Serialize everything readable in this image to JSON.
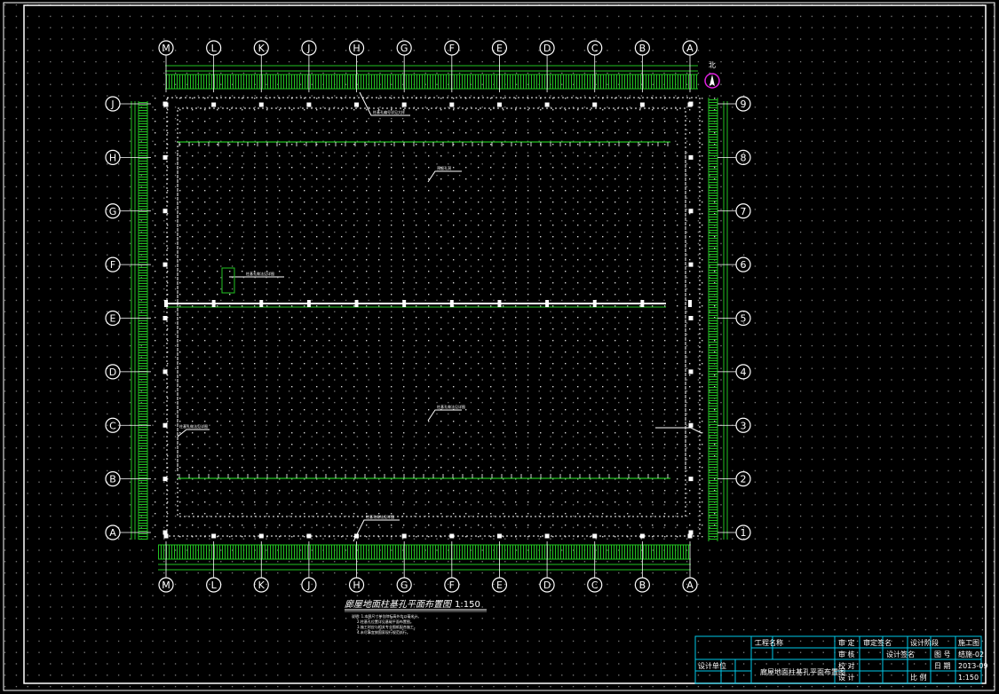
{
  "drawing": {
    "title": "廊屋地面柱基孔平面布置图",
    "scale": "1:150",
    "north_label": "北",
    "notes": [
      "说明: 1.本图尺寸单位除标高外均以毫米计。",
      "2.柱基孔位置详见基础平面布置图。",
      "3.施工时应与相关专业图纸配合施工。",
      "4.未尽事宜按国家现行规范执行。"
    ]
  },
  "grid": {
    "top_columns": [
      "M",
      "L",
      "K",
      "J",
      "H",
      "G",
      "F",
      "E",
      "D",
      "C",
      "B",
      "A"
    ],
    "bottom_columns": [
      "M",
      "L",
      "K",
      "J",
      "H",
      "G",
      "F",
      "E",
      "D",
      "C",
      "B",
      "A"
    ],
    "left_rows": [
      "J",
      "H",
      "G",
      "F",
      "E",
      "D",
      "C",
      "B",
      "A"
    ],
    "right_rows": [
      "9",
      "8",
      "7",
      "6",
      "5",
      "4",
      "3",
      "2",
      "1"
    ]
  },
  "callouts": [
    "柱基孔编号详见大样",
    "预留孔洞",
    "柱基孔做法见详图",
    "柱基孔做法见详图",
    "柱基孔做法见详图",
    "柱基孔做法见详图"
  ],
  "title_block": {
    "project_label": "工程名称",
    "drawing_name": "廊屋地面柱基孔平面布置图",
    "design_unit": "设计单位",
    "roles": [
      "审 定",
      "审 核",
      "校 对",
      "设 计"
    ],
    "stage_label": "设计阶段",
    "stage_value": "施工图",
    "sheet_no_label": "图 号",
    "sheet_no": "结施-02",
    "date_label": "日 期",
    "date": "2013-09",
    "scale_label": "比 例",
    "scale_value": "1:150",
    "checked": "审定签名",
    "drawn": "设计签名"
  },
  "colors": {
    "background": "#000000",
    "line": "#ffffff",
    "dimension": "#22c322",
    "titleblock": "#00c8e8",
    "north_circle": "#e020e0"
  }
}
